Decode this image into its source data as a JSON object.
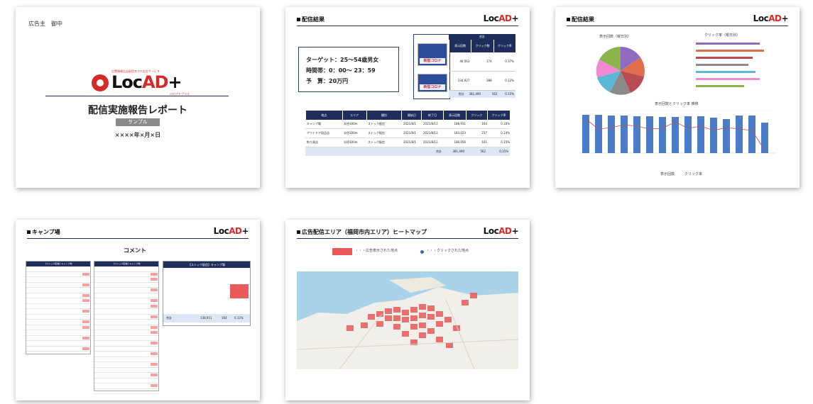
{
  "brand": {
    "logo_text_a": "Loc",
    "logo_text_b": "AD",
    "logo_plus": "+"
  },
  "slide1": {
    "addressee": "広告主　御中",
    "logo_tagline": "位置情報広告配信スマホ広告サービス",
    "logo_sub": "ロカアドプラス",
    "title": "配信実施報告レポート",
    "badge": "サンプル",
    "date": "××××年×月×日"
  },
  "slide2": {
    "header": "配信結果",
    "target": "ターゲット：25～54歳男女",
    "time": "時間帯：0：00～ 23：59",
    "budget": "予　算：20万円",
    "banner_text": "新型コロナ",
    "summary": {
      "top": "合計",
      "cols": [
        "表示回数",
        "クリック数",
        "クリック率"
      ],
      "rows": [
        [
          "46,563",
          "174",
          "0.37%"
        ],
        [
          "334,927",
          "388",
          "0.12%"
        ]
      ],
      "total_label": "合計",
      "total": [
        "381,490",
        "562",
        "0.15%"
      ]
    },
    "table": {
      "cols": [
        "地点",
        "エリア",
        "種別",
        "開始日",
        "終了日",
        "表示回数",
        "クリック",
        "クリック率"
      ],
      "rows": [
        [
          "キャンプ場",
          "半径300m",
          "ストック配信",
          "2021/8/1",
          "2021/8/13",
          "188,911",
          "164",
          "0.16%"
        ],
        [
          "アウトドア用品店",
          "半径300m",
          "ストック配信",
          "2021/8/1",
          "2021/8/13",
          "183,023",
          "237",
          "0.14%"
        ],
        [
          "釣り具店",
          "半径300m",
          "ストック配信",
          "2021/8/1",
          "2021/8/13",
          "189,056",
          "161",
          "0.15%"
        ]
      ],
      "total_label": "合計",
      "total": [
        "381,490",
        "562",
        "0.15%"
      ]
    }
  },
  "slide3": {
    "header": "配信結果",
    "pie_title": "表示回数（曜日別）",
    "bar_title": "クリック率（曜日別）",
    "trend_title": "表示回数とクリック率 推移",
    "legend": [
      "表示回数",
      "クリック率"
    ],
    "colors": {
      "bar": "#4a7cc7",
      "line": "#c0504d"
    }
  },
  "slide4": {
    "header": "キャンプ場",
    "comment": "コメント",
    "box_title": "【ストック配信】キャンプ場",
    "box_total_label": "合計",
    "box_total": [
      "138,911",
      "164",
      "0.12%"
    ]
  },
  "slide5": {
    "header": "広告配信エリア（福岡市内エリア）ヒートマップ",
    "legend_red": "・・・広告表示された地点",
    "legend_blue": "・・・クリックされた地点"
  }
}
